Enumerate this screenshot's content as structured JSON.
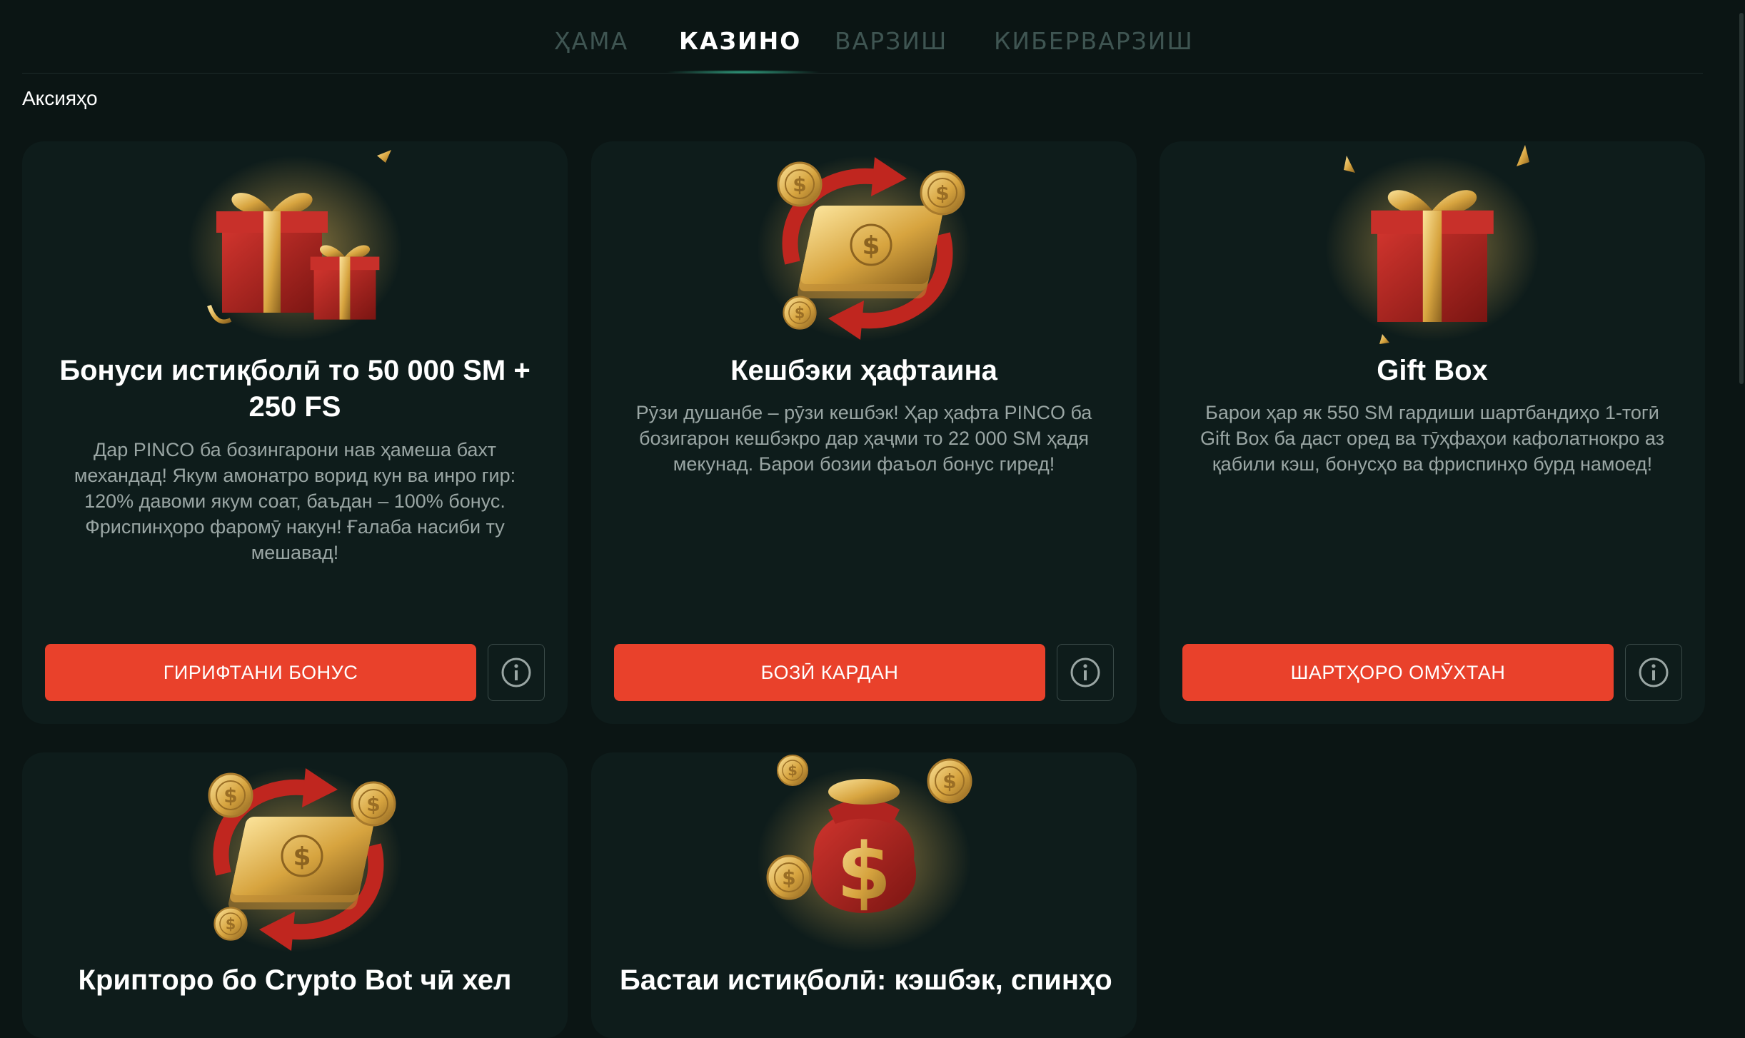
{
  "tabs": [
    {
      "label": "ҲАМА",
      "active": false
    },
    {
      "label": "КАЗИНО",
      "active": true
    },
    {
      "label": "ВАРЗИШ",
      "active": false
    },
    {
      "label": "КИБЕРВАРЗИШ",
      "active": false
    }
  ],
  "section_title": "Аксияҳо",
  "cards": [
    {
      "title": "Бонуси истиқболӣ то 50 000 SM + 250 FS",
      "description": "Дар PINCO ба бозингарони нав ҳамеша бахт механдад! Якум амонатро ворид кун ва инро гир: 120% давоми якум соат, баъдан – 100% бонус. Фриспинҳоро фаромӯ накун! Ғалаба насиби ту мешавад!",
      "button": "ГИРИФТАНИ БОНУС",
      "image": "gift-boxes-image"
    },
    {
      "title": "Кешбэки ҳафтаина",
      "description": "Рӯзи душанбе – рӯзи кешбэк! Ҳар ҳафта PINCO ба бозигарон кешбэкро дар ҳаҷми то 22 000 SM ҳадя мекунад. Барои бозии фаъол бонус гиред!",
      "button": "БОЗӢ КАРДАН",
      "image": "money-cashback-image"
    },
    {
      "title": "Gift Box",
      "description": "Барои ҳар як 550 SM гардиши шартбандиҳо 1-тогӣ Gift Box ба даст оред ва тӯҳфаҳои кафолатнокро аз қабили кэш, бонусҳо ва фриспинҳо бурд намоед!",
      "button": "ШАРТҲОРО ОМӮХТАН",
      "image": "gift-box-image"
    },
    {
      "title": "Крипторо бо Crypto Bot чӣ хел",
      "image": "money-cashback-image"
    },
    {
      "title": "Бастаи истиқболӣ: кэшбэк, спинҳо",
      "image": "money-bag-image"
    }
  ],
  "colors": {
    "background": "#0b1514",
    "card": "#0e1c1b",
    "accent": "#e9412b",
    "muted_text": "#9aa6a4"
  },
  "icons": {
    "info": "info-icon"
  }
}
